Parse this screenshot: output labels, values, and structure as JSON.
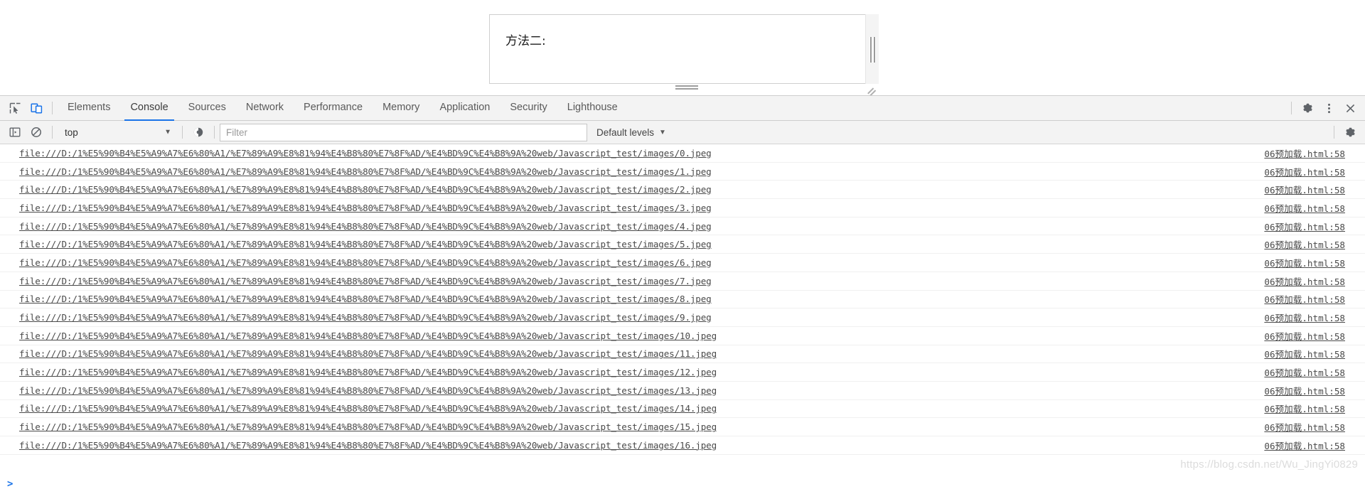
{
  "page": {
    "textarea_text": "方法二:",
    "scrollbar": "vertical-scrollbar",
    "resize_grip": "resize-grip"
  },
  "devtools": {
    "tabs": [
      {
        "label": "Elements",
        "active": false
      },
      {
        "label": "Console",
        "active": true
      },
      {
        "label": "Sources",
        "active": false
      },
      {
        "label": "Network",
        "active": false
      },
      {
        "label": "Performance",
        "active": false
      },
      {
        "label": "Memory",
        "active": false
      },
      {
        "label": "Application",
        "active": false
      },
      {
        "label": "Security",
        "active": false
      },
      {
        "label": "Lighthouse",
        "active": false
      }
    ],
    "left_icons": [
      {
        "name": "inspect-element-icon",
        "title": "Inspect"
      },
      {
        "name": "device-toolbar-icon",
        "title": "Toggle device toolbar"
      }
    ],
    "right_icons": [
      {
        "name": "settings-gear-icon",
        "title": "Settings"
      },
      {
        "name": "more-options-icon",
        "title": "Customize and control DevTools"
      },
      {
        "name": "close-icon",
        "title": "Close DevTools"
      }
    ],
    "toolbar": {
      "sidebar_toggle": "console-sidebar-icon",
      "clear_console": "clear-console-icon",
      "context_value": "top",
      "context_caret": "▼",
      "live_expression": "eye-icon",
      "filter_placeholder": "Filter",
      "filter_value": "",
      "levels_label": "Default levels",
      "levels_caret": "▼",
      "settings": "console-settings-gear-icon"
    },
    "console": {
      "url_prefix": "file:///D:/1%E5%90%B4%E5%A9%A7%E6%80%A1/%E7%89%A9%E8%81%94%E4%B8%80%E7%8F%AD/%E4%BD%9C%E4%B8%9A%20web/Javascript_test/images/",
      "source_label": "06预加载.html:58",
      "rows": [
        {
          "url": "file:///D:/1%E5%90%B4%E5%A9%A7%E6%80%A1/%E7%89%A9%E8%81%94%E4%B8%80%E7%8F%AD/%E4%BD%9C%E4%B8%9A%20web/Javascript_test/images/0.jpeg",
          "source": "06预加载.html:58"
        },
        {
          "url": "file:///D:/1%E5%90%B4%E5%A9%A7%E6%80%A1/%E7%89%A9%E8%81%94%E4%B8%80%E7%8F%AD/%E4%BD%9C%E4%B8%9A%20web/Javascript_test/images/1.jpeg",
          "source": "06预加载.html:58"
        },
        {
          "url": "file:///D:/1%E5%90%B4%E5%A9%A7%E6%80%A1/%E7%89%A9%E8%81%94%E4%B8%80%E7%8F%AD/%E4%BD%9C%E4%B8%9A%20web/Javascript_test/images/2.jpeg",
          "source": "06预加载.html:58"
        },
        {
          "url": "file:///D:/1%E5%90%B4%E5%A9%A7%E6%80%A1/%E7%89%A9%E8%81%94%E4%B8%80%E7%8F%AD/%E4%BD%9C%E4%B8%9A%20web/Javascript_test/images/3.jpeg",
          "source": "06预加载.html:58"
        },
        {
          "url": "file:///D:/1%E5%90%B4%E5%A9%A7%E6%80%A1/%E7%89%A9%E8%81%94%E4%B8%80%E7%8F%AD/%E4%BD%9C%E4%B8%9A%20web/Javascript_test/images/4.jpeg",
          "source": "06预加载.html:58"
        },
        {
          "url": "file:///D:/1%E5%90%B4%E5%A9%A7%E6%80%A1/%E7%89%A9%E8%81%94%E4%B8%80%E7%8F%AD/%E4%BD%9C%E4%B8%9A%20web/Javascript_test/images/5.jpeg",
          "source": "06预加载.html:58"
        },
        {
          "url": "file:///D:/1%E5%90%B4%E5%A9%A7%E6%80%A1/%E7%89%A9%E8%81%94%E4%B8%80%E7%8F%AD/%E4%BD%9C%E4%B8%9A%20web/Javascript_test/images/6.jpeg",
          "source": "06预加载.html:58"
        },
        {
          "url": "file:///D:/1%E5%90%B4%E5%A9%A7%E6%80%A1/%E7%89%A9%E8%81%94%E4%B8%80%E7%8F%AD/%E4%BD%9C%E4%B8%9A%20web/Javascript_test/images/7.jpeg",
          "source": "06预加载.html:58"
        },
        {
          "url": "file:///D:/1%E5%90%B4%E5%A9%A7%E6%80%A1/%E7%89%A9%E8%81%94%E4%B8%80%E7%8F%AD/%E4%BD%9C%E4%B8%9A%20web/Javascript_test/images/8.jpeg",
          "source": "06预加载.html:58"
        },
        {
          "url": "file:///D:/1%E5%90%B4%E5%A9%A7%E6%80%A1/%E7%89%A9%E8%81%94%E4%B8%80%E7%8F%AD/%E4%BD%9C%E4%B8%9A%20web/Javascript_test/images/9.jpeg",
          "source": "06预加载.html:58"
        },
        {
          "url": "file:///D:/1%E5%90%B4%E5%A9%A7%E6%80%A1/%E7%89%A9%E8%81%94%E4%B8%80%E7%8F%AD/%E4%BD%9C%E4%B8%9A%20web/Javascript_test/images/10.jpeg",
          "source": "06预加载.html:58"
        },
        {
          "url": "file:///D:/1%E5%90%B4%E5%A9%A7%E6%80%A1/%E7%89%A9%E8%81%94%E4%B8%80%E7%8F%AD/%E4%BD%9C%E4%B8%9A%20web/Javascript_test/images/11.jpeg",
          "source": "06预加载.html:58"
        },
        {
          "url": "file:///D:/1%E5%90%B4%E5%A9%A7%E6%80%A1/%E7%89%A9%E8%81%94%E4%B8%80%E7%8F%AD/%E4%BD%9C%E4%B8%9A%20web/Javascript_test/images/12.jpeg",
          "source": "06预加载.html:58"
        },
        {
          "url": "file:///D:/1%E5%90%B4%E5%A9%A7%E6%80%A1/%E7%89%A9%E8%81%94%E4%B8%80%E7%8F%AD/%E4%BD%9C%E4%B8%9A%20web/Javascript_test/images/13.jpeg",
          "source": "06预加载.html:58"
        },
        {
          "url": "file:///D:/1%E5%90%B4%E5%A9%A7%E6%80%A1/%E7%89%A9%E8%81%94%E4%B8%80%E7%8F%AD/%E4%BD%9C%E4%B8%9A%20web/Javascript_test/images/14.jpeg",
          "source": "06预加载.html:58"
        },
        {
          "url": "file:///D:/1%E5%90%B4%E5%A9%A7%E6%80%A1/%E7%89%A9%E8%81%94%E4%B8%80%E7%8F%AD/%E4%BD%9C%E4%B8%9A%20web/Javascript_test/images/15.jpeg",
          "source": "06预加载.html:58"
        },
        {
          "url": "file:///D:/1%E5%90%B4%E5%A9%A7%E6%80%A1/%E7%89%A9%E8%81%94%E4%B8%80%E7%8F%AD/%E4%BD%9C%E4%B8%9A%20web/Javascript_test/images/16.jpeg",
          "source": "06预加载.html:58"
        }
      ],
      "prompt_caret": ">",
      "prompt_value": ""
    }
  },
  "watermark": "https://blog.csdn.net/Wu_JingYi0829",
  "colors": {
    "accent": "#1a73e8",
    "toolbar_bg": "#f3f3f3",
    "text": "#4a4a4a",
    "border": "#cdcdcd"
  }
}
